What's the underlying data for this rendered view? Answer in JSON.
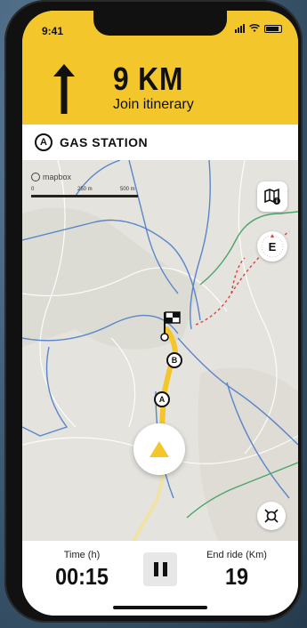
{
  "status_bar": {
    "time": "9:41"
  },
  "navigation": {
    "distance": "9 KM",
    "instruction": "Join itinerary"
  },
  "poi": {
    "badge": "A",
    "label": "GAS STATION"
  },
  "map": {
    "attribution": "mapbox",
    "scale": {
      "start": "0",
      "mid": "250 m",
      "end": "500 m"
    },
    "compass_heading": "E",
    "waypoints": [
      "A",
      "B"
    ],
    "route_color": "#f3c72b",
    "icons": {
      "layers": "map-info-icon",
      "compass": "compass-icon",
      "recenter": "recenter-icon",
      "finish": "finish-flag-icon",
      "navigation": "navigation-arrow-icon"
    }
  },
  "ride": {
    "time_label": "Time (h)",
    "time_value": "00:15",
    "end_label": "End ride (Km)",
    "end_value": "19"
  },
  "colors": {
    "accent": "#f3c72b",
    "route_secondary": "#f0e4a8"
  }
}
